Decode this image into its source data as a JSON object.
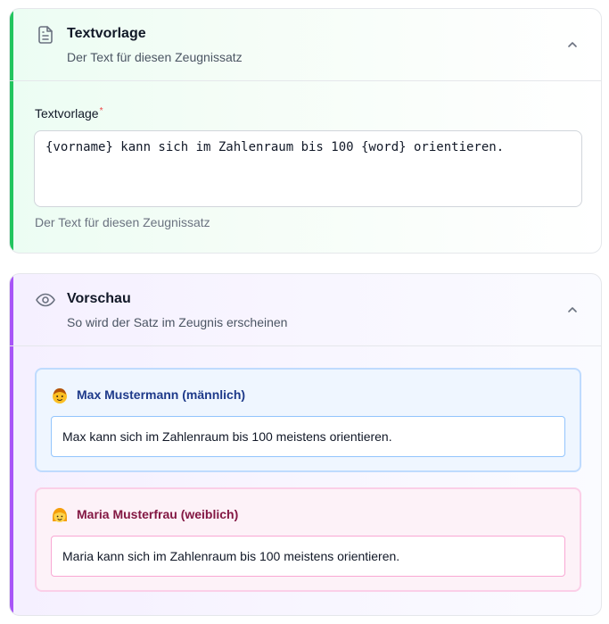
{
  "template_card": {
    "title": "Textvorlage",
    "subtitle": "Der Text für diesen Zeugnissatz",
    "icon": "document-icon",
    "field_label": "Textvorlage",
    "required_marker": "*",
    "field_value": "{vorname} kann sich im Zahlenraum bis 100 {word} orientieren.",
    "help_text": "Der Text für diesen Zeugnissatz",
    "accent_color": "#22c55e"
  },
  "preview_card": {
    "title": "Vorschau",
    "subtitle": "So wird der Satz im Zeugnis erscheinen",
    "icon": "eye-icon",
    "accent_color": "#a855f7",
    "male": {
      "name": "Max Mustermann (männlich)",
      "icon": "boy-emoji-icon",
      "text": "Max kann sich im Zahlenraum bis 100 meistens orientieren.",
      "color": "#1e3a8a"
    },
    "female": {
      "name": "Maria Musterfrau (weiblich)",
      "icon": "girl-emoji-icon",
      "text": "Maria kann sich im Zahlenraum bis 100 meistens orientieren.",
      "color": "#831843"
    }
  }
}
